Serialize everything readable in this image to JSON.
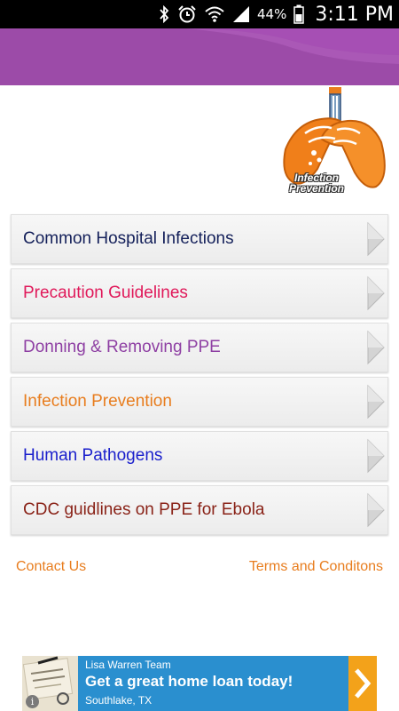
{
  "status_bar": {
    "battery_percent": "44%",
    "time": "3:11 PM",
    "icons": [
      "bluetooth-icon",
      "alarm-icon",
      "wifi-icon",
      "signal-icon",
      "battery-icon"
    ]
  },
  "logo": {
    "line1": "Infection",
    "line2": "Prevention"
  },
  "menu": {
    "items": [
      {
        "label": "Common Hospital Infections",
        "color": "#14205a"
      },
      {
        "label": "Precaution Guidelines",
        "color": "#e0195a"
      },
      {
        "label": "Donning & Removing PPE",
        "color": "#8e3fa3"
      },
      {
        "label": "Infection Prevention",
        "color": "#e87d1e"
      },
      {
        "label": "Human Pathogens",
        "color": "#1a1fcc"
      },
      {
        "label": "CDC guidlines on PPE for Ebola",
        "color": "#8a2318"
      }
    ]
  },
  "footer_links": {
    "contact": "Contact Us",
    "terms": "Terms and Conditons"
  },
  "ad": {
    "advertiser": "Lisa Warren Team",
    "headline": "Get a great home loan today!",
    "location": "Southlake, TX",
    "info_symbol": "i"
  },
  "colors": {
    "banner": "#9c4ba8",
    "link": "#e87d1e",
    "ad_background": "#2a8fcf",
    "ad_arrow": "#f3a21a"
  }
}
